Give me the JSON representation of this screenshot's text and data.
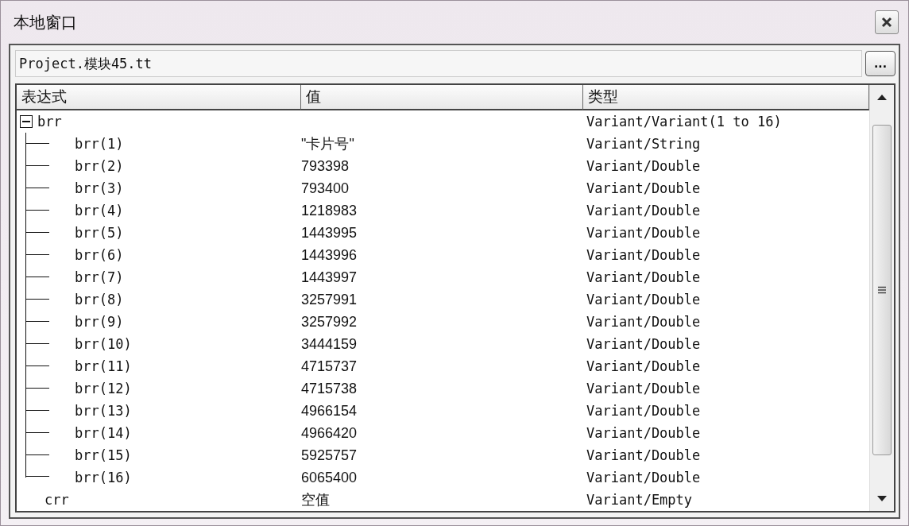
{
  "window": {
    "title": "本地窗口"
  },
  "context": {
    "value": "Project.模块45.tt",
    "button": "..."
  },
  "columns": [
    "表达式",
    "值",
    "类型"
  ],
  "locals": [
    {
      "expression": "brr",
      "type": "Variant/Variant(1 to 16)",
      "expanded": true,
      "children": [
        {
          "expression": "brr(1)",
          "value": "\"卡片号\"",
          "type": "Variant/String"
        },
        {
          "expression": "brr(2)",
          "value": "793398",
          "type": "Variant/Double"
        },
        {
          "expression": "brr(3)",
          "value": "793400",
          "type": "Variant/Double"
        },
        {
          "expression": "brr(4)",
          "value": "1218983",
          "type": "Variant/Double"
        },
        {
          "expression": "brr(5)",
          "value": "1443995",
          "type": "Variant/Double"
        },
        {
          "expression": "brr(6)",
          "value": "1443996",
          "type": "Variant/Double"
        },
        {
          "expression": "brr(7)",
          "value": "1443997",
          "type": "Variant/Double"
        },
        {
          "expression": "brr(8)",
          "value": "3257991",
          "type": "Variant/Double"
        },
        {
          "expression": "brr(9)",
          "value": "3257992",
          "type": "Variant/Double"
        },
        {
          "expression": "brr(10)",
          "value": "3444159",
          "type": "Variant/Double"
        },
        {
          "expression": "brr(11)",
          "value": "4715737",
          "type": "Variant/Double"
        },
        {
          "expression": "brr(12)",
          "value": "4715738",
          "type": "Variant/Double"
        },
        {
          "expression": "brr(13)",
          "value": "4966154",
          "type": "Variant/Double"
        },
        {
          "expression": "brr(14)",
          "value": "4966420",
          "type": "Variant/Double"
        },
        {
          "expression": "brr(15)",
          "value": "5925757",
          "type": "Variant/Double"
        },
        {
          "expression": "brr(16)",
          "value": "6065400",
          "type": "Variant/Double"
        }
      ]
    },
    {
      "expression": "crr",
      "value": "空值",
      "type": "Variant/Empty"
    }
  ]
}
